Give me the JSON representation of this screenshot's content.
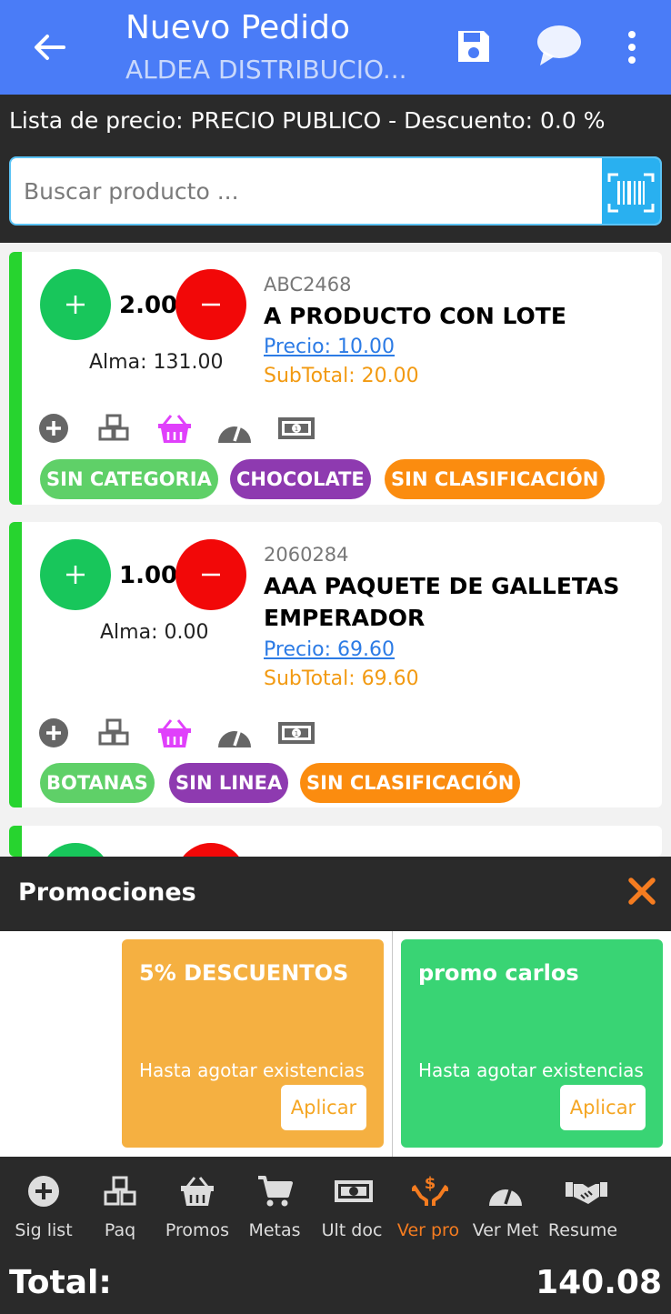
{
  "appbar": {
    "title": "Nuevo Pedido",
    "subtitle": "ALDEA DISTRIBUCIO...",
    "back_icon": "arrow-left-icon",
    "save_icon": "save-icon",
    "chat_icon": "chat-bubble-icon",
    "more_icon": "more-vert-icon",
    "color": "#4a7cf7"
  },
  "pricebar": {
    "text": "Lista de precio: PRECIO PUBLICO - Descuento: 0.0 %"
  },
  "search": {
    "placeholder": "Buscar producto ...",
    "scan_icon": "barcode-scan-icon"
  },
  "products": [
    {
      "qty": "2.00",
      "alma": "Alma: 131.00",
      "code": "ABC2468",
      "name": "A PRODUCTO CON LOTE",
      "precio": "Precio: 10.00",
      "subtotal": "SubTotal: 20.00",
      "chips": [
        {
          "label": "SIN CATEGORIA",
          "color": "#5fd068"
        },
        {
          "label": "CHOCOLATE",
          "color": "#8e3ab0"
        },
        {
          "label": "SIN CLASIFICACIÓN",
          "color": "#fb8c0f"
        }
      ]
    },
    {
      "qty": "1.00",
      "alma": "Alma: 0.00",
      "code": "2060284",
      "name": "AAA PAQUETE DE GALLETAS EMPERADOR",
      "precio": "Precio: 69.60",
      "subtotal": "SubTotal: 69.60",
      "chips": [
        {
          "label": "BOTANAS",
          "color": "#5fd068"
        },
        {
          "label": "SIN LINEA",
          "color": "#8e3ab0"
        },
        {
          "label": "SIN CLASIFICACIÓN",
          "color": "#fb8c0f"
        }
      ]
    }
  ],
  "promotions": {
    "title": "Promociones",
    "close_icon": "close-icon",
    "items": [
      {
        "title": "5% DESCUENTOS",
        "desc": "Hasta agotar existencias",
        "button": "Aplicar",
        "color": "#f5b041",
        "text_color": "#f5a623"
      },
      {
        "title": "promo carlos",
        "desc": "Hasta agotar existencias",
        "button": "Aplicar",
        "color": "#39d474",
        "text_color": "#2ecc71"
      }
    ]
  },
  "bottomnav": {
    "items": [
      {
        "label": "Sig list",
        "icon": "plus-circle-icon"
      },
      {
        "label": "Paq",
        "icon": "boxes-icon"
      },
      {
        "label": "Promos",
        "icon": "basket-icon"
      },
      {
        "label": "Metas",
        "icon": "cart-icon"
      },
      {
        "label": "Ult doc",
        "icon": "money-icon"
      },
      {
        "label": "Ver pro",
        "icon": "hand-dollar-icon",
        "active": true
      },
      {
        "label": "Ver Met",
        "icon": "gauge-icon"
      },
      {
        "label": "Resume",
        "icon": "handshake-icon"
      }
    ],
    "total_label": "Total:",
    "total_value": "140.08",
    "active_color": "#f57c20"
  }
}
